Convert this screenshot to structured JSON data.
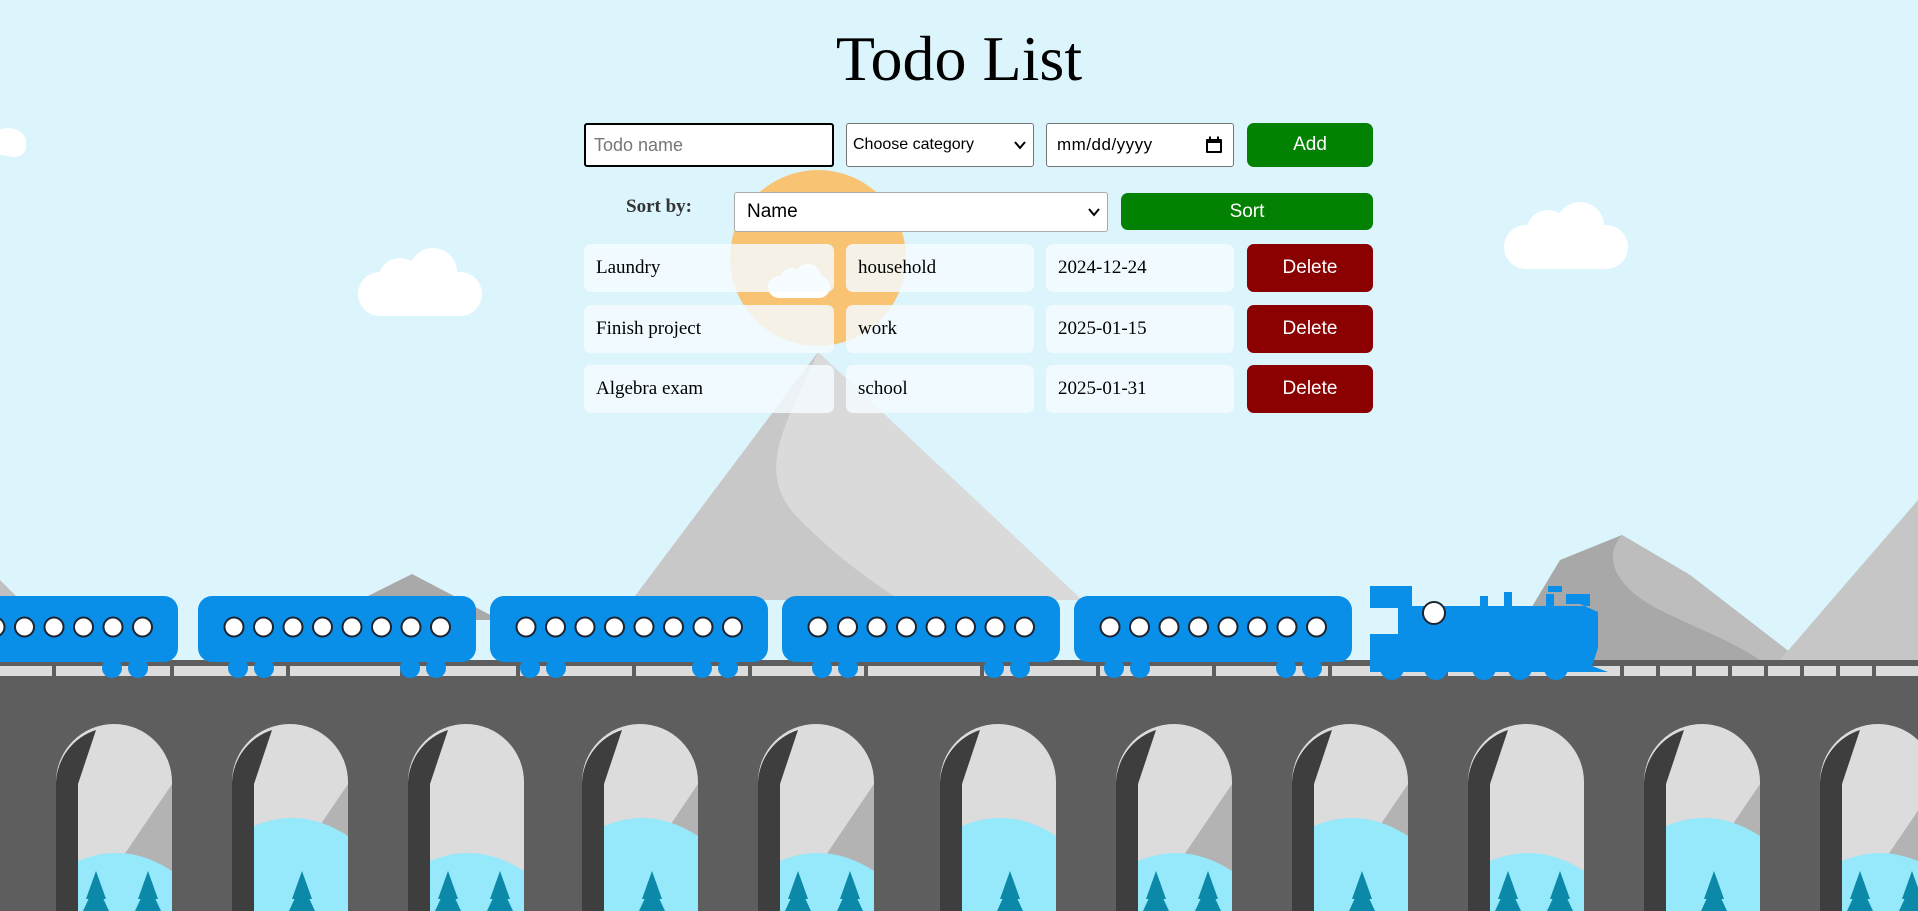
{
  "title": "Todo List",
  "form": {
    "name_placeholder": "Todo name",
    "category_selected": "Choose category",
    "date_placeholder": "mm/dd/yyyy",
    "add_label": "Add"
  },
  "sort": {
    "label": "Sort by:",
    "selected": "Name",
    "button_label": "Sort"
  },
  "todos": [
    {
      "name": "Laundry",
      "category": "household",
      "date": "2024-12-24",
      "delete_label": "Delete"
    },
    {
      "name": "Finish project",
      "category": "work",
      "date": "2025-01-15",
      "delete_label": "Delete"
    },
    {
      "name": "Algebra exam",
      "category": "school",
      "date": "2025-01-31",
      "delete_label": "Delete"
    }
  ],
  "colors": {
    "sky": "#dcf5fd",
    "primary_button": "#028102",
    "delete_button": "#8b0000",
    "train": "#0a8fe8",
    "bridge": "#5e5e5e",
    "sun": "#f9c06b"
  },
  "icons": {
    "select_arrow": "chevron-down-icon",
    "date_picker": "calendar-icon"
  }
}
